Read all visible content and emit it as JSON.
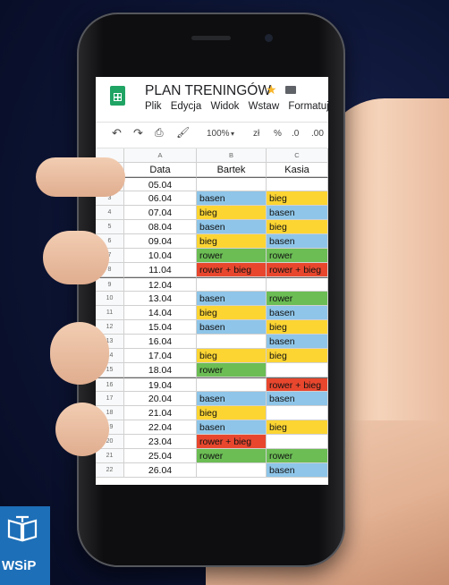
{
  "document": {
    "title": "PLAN TRENINGÓW",
    "menu": [
      "Plik",
      "Edycja",
      "Widok",
      "Wstaw",
      "Formatuj"
    ],
    "toolbar": {
      "zoom": "100%",
      "currency": "zł",
      "percent": "%",
      "dec_less": ".0",
      "dec_more": ".00"
    }
  },
  "sheet": {
    "column_letters": [
      "A",
      "B",
      "C"
    ],
    "headers": [
      "Data",
      "Bartek",
      "Kasia"
    ],
    "rows": [
      {
        "n": "2",
        "date": "05.04",
        "bartek": "",
        "kasia": "",
        "week_start": true
      },
      {
        "n": "3",
        "date": "06.04",
        "bartek": "basen",
        "kasia": "bieg"
      },
      {
        "n": "4",
        "date": "07.04",
        "bartek": "bieg",
        "kasia": "basen"
      },
      {
        "n": "5",
        "date": "08.04",
        "bartek": "basen",
        "kasia": "bieg"
      },
      {
        "n": "6",
        "date": "09.04",
        "bartek": "bieg",
        "kasia": "basen"
      },
      {
        "n": "7",
        "date": "10.04",
        "bartek": "rower",
        "kasia": "rower"
      },
      {
        "n": "8",
        "date": "11.04",
        "bartek": "rower + bieg",
        "kasia": "rower + bieg"
      },
      {
        "n": "9",
        "date": "12.04",
        "bartek": "",
        "kasia": "",
        "week_start": true
      },
      {
        "n": "10",
        "date": "13.04",
        "bartek": "basen",
        "kasia": "rower"
      },
      {
        "n": "11",
        "date": "14.04",
        "bartek": "bieg",
        "kasia": "basen"
      },
      {
        "n": "12",
        "date": "15.04",
        "bartek": "basen",
        "kasia": "bieg"
      },
      {
        "n": "13",
        "date": "16.04",
        "bartek": "",
        "kasia": "basen"
      },
      {
        "n": "14",
        "date": "17.04",
        "bartek": "bieg",
        "kasia": "bieg"
      },
      {
        "n": "15",
        "date": "18.04",
        "bartek": "rower",
        "kasia": ""
      },
      {
        "n": "16",
        "date": "19.04",
        "bartek": "",
        "kasia": "rower + bieg",
        "week_start": true
      },
      {
        "n": "17",
        "date": "20.04",
        "bartek": "basen",
        "kasia": "basen"
      },
      {
        "n": "18",
        "date": "21.04",
        "bartek": "bieg",
        "kasia": ""
      },
      {
        "n": "19",
        "date": "22.04",
        "bartek": "basen",
        "kasia": "bieg"
      },
      {
        "n": "20",
        "date": "23.04",
        "bartek": "rower + bieg",
        "kasia": ""
      },
      {
        "n": "21",
        "date": "25.04",
        "bartek": "rower",
        "kasia": "rower"
      },
      {
        "n": "22",
        "date": "26.04",
        "bartek": "",
        "kasia": "basen"
      }
    ]
  },
  "activity_colors": {
    "basen": "#8ec5e8",
    "bieg": "#fcd533",
    "rower": "#6bbd54",
    "rower + bieg": "#e8472e"
  },
  "logo": {
    "text": "WSiP",
    "color": "#1d6fb8"
  }
}
